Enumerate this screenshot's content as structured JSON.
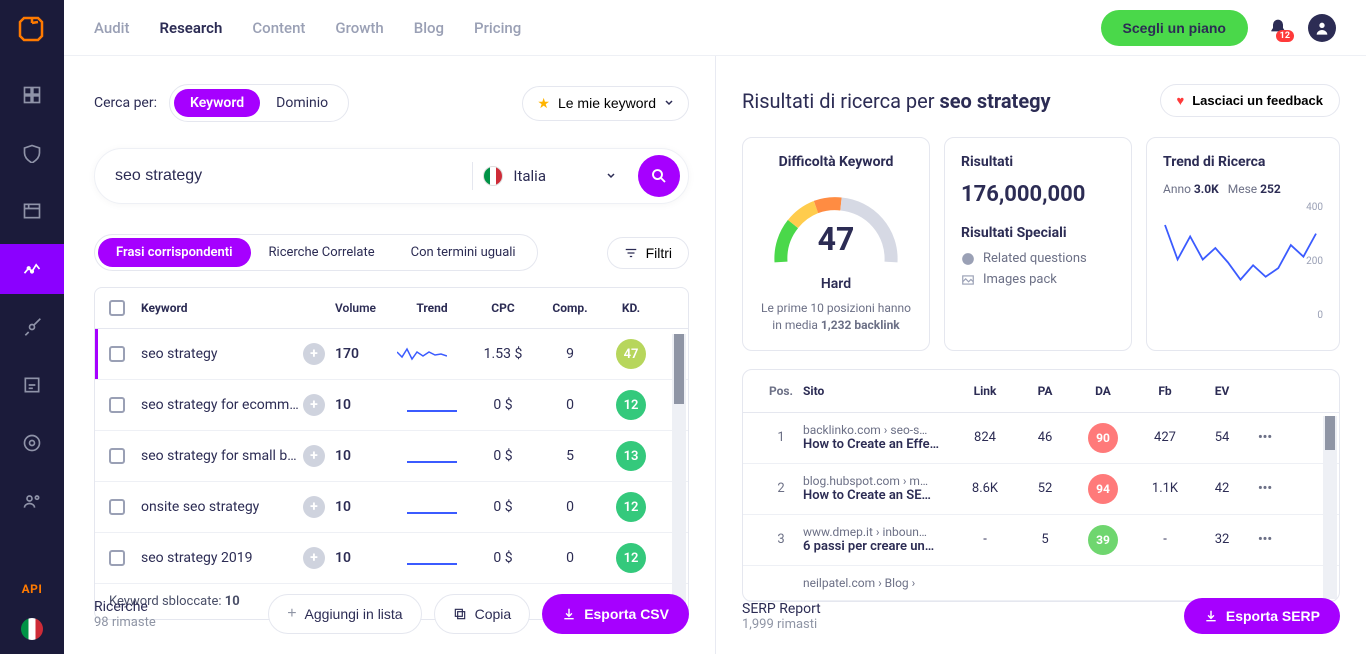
{
  "topnav": {
    "links": [
      "Audit",
      "Research",
      "Content",
      "Growth",
      "Blog",
      "Pricing"
    ],
    "active_index": 1,
    "plan_btn": "Scegli un piano",
    "notif_count": "12"
  },
  "sidebar": {
    "api_label": "API"
  },
  "search": {
    "label": "Cerca per:",
    "pills": [
      "Keyword",
      "Dominio"
    ],
    "my_keywords": "Le mie keyword",
    "value": "seo strategy",
    "country": "Italia"
  },
  "kw_tabs": [
    "Frasi corrispondenti",
    "Ricerche Correlate",
    "Con termini uguali"
  ],
  "filter_btn": "Filtri",
  "kw_headers": {
    "keyword": "Keyword",
    "volume": "Volume",
    "trend": "Trend",
    "cpc": "CPC",
    "comp": "Comp.",
    "kd": "KD."
  },
  "kw_rows": [
    {
      "kw": "seo strategy",
      "vol": "170",
      "cpc": "1.53 $",
      "comp": "9",
      "kd": "47",
      "kd_color": "#b7d65c",
      "selected": true
    },
    {
      "kw": "seo strategy for ecomm…",
      "vol": "10",
      "cpc": "0 $",
      "comp": "0",
      "kd": "12",
      "kd_color": "#34c97c"
    },
    {
      "kw": "seo strategy for small b…",
      "vol": "10",
      "cpc": "0 $",
      "comp": "5",
      "kd": "13",
      "kd_color": "#34c97c"
    },
    {
      "kw": "onsite seo strategy",
      "vol": "10",
      "cpc": "0 $",
      "comp": "0",
      "kd": "12",
      "kd_color": "#34c97c"
    },
    {
      "kw": "seo strategy 2019",
      "vol": "10",
      "cpc": "0 $",
      "comp": "0",
      "kd": "12",
      "kd_color": "#34c97c"
    }
  ],
  "unlocked": {
    "prefix": "Keyword sbloccate: ",
    "count": "10"
  },
  "footer_left": {
    "searches_label": "Ricerche",
    "searches_remaining": "98 rimaste",
    "add_list": "Aggiungi in lista",
    "copy": "Copia",
    "export": "Esporta CSV"
  },
  "right": {
    "title_prefix": "Risultati di ricerca per ",
    "title_term": "seo strategy",
    "feedback": "Lasciaci un feedback",
    "diff_title": "Difficoltà Keyword",
    "diff_value": "47",
    "diff_label": "Hard",
    "diff_note_prefix": "Le prime 10 posizioni hanno in media ",
    "diff_note_bold": "1,232 backlink",
    "res_title": "Risultati",
    "res_value": "176,000,000",
    "special_title": "Risultati Speciali",
    "special_items": [
      "Related questions",
      "Images pack"
    ],
    "trend_title": "Trend di Ricerca",
    "trend_year_label": "Anno",
    "trend_year_val": "3.0K",
    "trend_month_label": "Mese",
    "trend_month_val": "252",
    "trend_ticks": [
      "400",
      "200",
      "0"
    ]
  },
  "serp_headers": {
    "pos": "Pos.",
    "site": "Sito",
    "link": "Link",
    "pa": "PA",
    "da": "DA",
    "fb": "Fb",
    "ev": "EV"
  },
  "serp_rows": [
    {
      "pos": "1",
      "url": "backlinko.com › seo-s…",
      "title": "How to Create an Effe…",
      "link": "824",
      "pa": "46",
      "da": "90",
      "da_color": "#ff7a7a",
      "fb": "427",
      "ev": "54"
    },
    {
      "pos": "2",
      "url": "blog.hubspot.com › m…",
      "title": "How to Create an SE…",
      "link": "8.6K",
      "pa": "52",
      "da": "94",
      "da_color": "#ff7a7a",
      "fb": "1.1K",
      "ev": "42"
    },
    {
      "pos": "3",
      "url": "www.dmep.it › inboun…",
      "title": "6 passi per creare un…",
      "link": "-",
      "pa": "5",
      "da": "39",
      "da_color": "#6fd66f",
      "fb": "-",
      "ev": "32"
    },
    {
      "pos": "",
      "url": "neilpatel.com › Blog ›",
      "title": "",
      "link": "",
      "pa": "",
      "da": "",
      "da_color": "",
      "fb": "",
      "ev": ""
    }
  ],
  "footer_right": {
    "label": "SERP Report",
    "remaining": "1,999 rimasti",
    "export": "Esporta SERP"
  },
  "chart_data": {
    "type": "line",
    "title": "Trend di Ricerca",
    "ylim": [
      0,
      400
    ],
    "values": [
      320,
      200,
      280,
      200,
      240,
      190,
      130,
      180,
      140,
      170,
      250,
      210,
      290
    ]
  }
}
